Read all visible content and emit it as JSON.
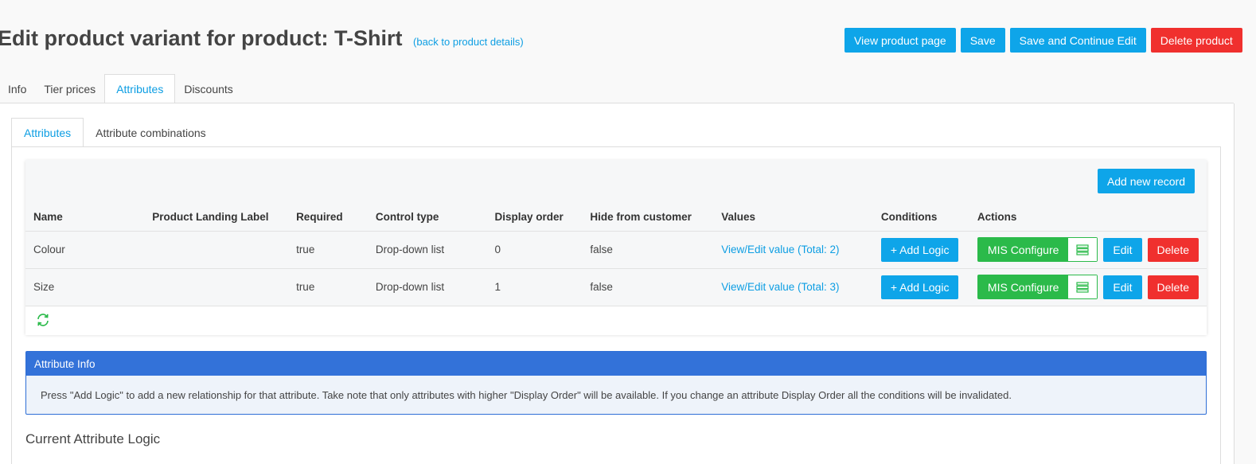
{
  "page": {
    "title": "Edit product variant for product: T-Shirt",
    "back_link": "(back to product details)"
  },
  "top_actions": {
    "view_product_page": "View product page",
    "save": "Save",
    "save_continue": "Save and Continue Edit",
    "delete_product": "Delete product"
  },
  "main_tabs": [
    "Info",
    "Tier prices",
    "Attributes",
    "Discounts"
  ],
  "main_active_tab": "Attributes",
  "sub_tabs": [
    "Attributes",
    "Attribute combinations"
  ],
  "sub_active_tab": "Attributes",
  "grid": {
    "add_new_record": "Add new record",
    "columns": [
      "Name",
      "Product Landing Label",
      "Required",
      "Control type",
      "Display order",
      "Hide from customer",
      "Values",
      "Conditions",
      "Actions"
    ],
    "rows": [
      {
        "name": "Colour",
        "landing_label": "",
        "required": "true",
        "control_type": "Drop-down list",
        "display_order": "0",
        "hide_from_customer": "false",
        "values": "View/Edit value (Total: 2)",
        "add_logic": "+ Add Logic",
        "mis_configure": "MIS Configure",
        "edit": "Edit",
        "delete": "Delete"
      },
      {
        "name": "Size",
        "landing_label": "",
        "required": "true",
        "control_type": "Drop-down list",
        "display_order": "1",
        "hide_from_customer": "false",
        "values": "View/Edit value (Total: 3)",
        "add_logic": "+ Add Logic",
        "mis_configure": "MIS Configure",
        "edit": "Edit",
        "delete": "Delete"
      }
    ]
  },
  "info_panel": {
    "title": "Attribute Info",
    "text": "Press \"Add Logic\" to add a new relationship for that attribute. Take note that only attributes with higher \"Display Order\" will be available. If you change an attribute Display Order all the conditions will be invalidated."
  },
  "logic_section_title": "Current Attribute Logic",
  "colors": {
    "primary": "#0ea5e9",
    "danger": "#f0302e",
    "success": "#2bba4a",
    "info_header": "#3372d9"
  }
}
